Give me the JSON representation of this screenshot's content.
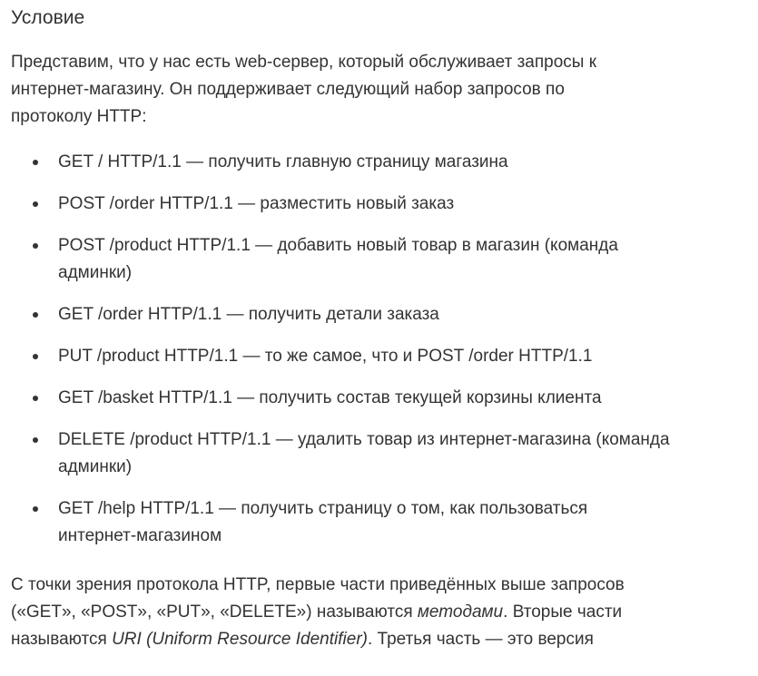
{
  "heading": "Условие",
  "intro": {
    "line1": "Представим, что у нас есть web-сервер, который обслуживает запросы к",
    "line2": "интернет-магазину. Он поддерживает следующий набор запросов по",
    "line3": "протоколу HTTP:"
  },
  "requests": [
    {
      "lines": [
        "GET / HTTP/1.1 — получить главную страницу магазина"
      ]
    },
    {
      "lines": [
        "POST /order HTTP/1.1 — разместить новый заказ"
      ]
    },
    {
      "lines": [
        "POST /product HTTP/1.1 — добавить новый товар в магазин (команда",
        "админки)"
      ]
    },
    {
      "lines": [
        "GET /order HTTP/1.1 — получить детали заказа"
      ]
    },
    {
      "lines": [
        "PUT /product HTTP/1.1 — то же самое, что и POST /order HTTP/1.1"
      ]
    },
    {
      "lines": [
        "GET /basket HTTP/1.1 — получить состав текущей корзины клиента"
      ]
    },
    {
      "lines": [
        "DELETE /product HTTP/1.1 — удалить товар из интернет-магазина (команда",
        "админки)"
      ]
    },
    {
      "lines": [
        "GET /help HTTP/1.1 — получить страницу о том, как пользоваться",
        "интернет-магазином"
      ]
    }
  ],
  "outro": {
    "line1": "С точки зрения протокола HTTP, первые части приведённых выше запросов",
    "line2_pre": "(«GET», «POST», «PUT», «DELETE») называются ",
    "line2_em": "методами",
    "line2_post": ". Вторые части",
    "line3_pre": "называются ",
    "line3_em": "URI (Uniform Resource Identifier)",
    "line3_post": ". Третья часть — это версия"
  }
}
